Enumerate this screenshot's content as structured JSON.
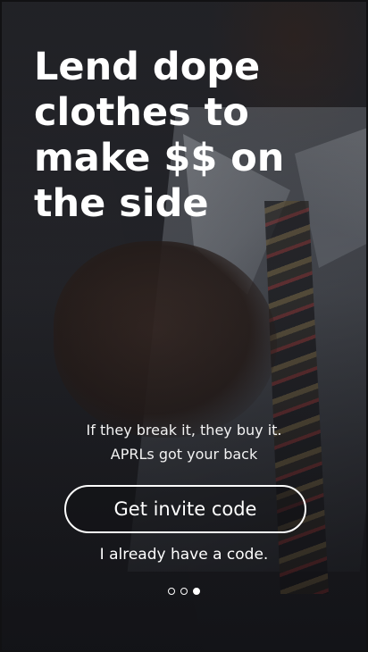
{
  "onboarding": {
    "headline": "Lend dope\nclothes to\nmake $$ on\nthe side",
    "subtext": "If they break it, they buy it. APRLs got your back",
    "primary_button_label": "Get invite code",
    "secondary_link_label": "I already have a code.",
    "pager": {
      "total_pages": 3,
      "active_page": 3
    }
  },
  "colors": {
    "text": "#ffffff",
    "button_border": "#ffffff",
    "background": "#2a2a2e"
  }
}
